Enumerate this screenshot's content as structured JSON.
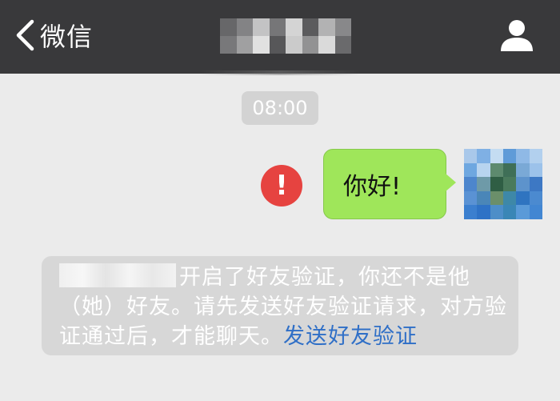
{
  "navbar": {
    "back_label": "微信",
    "title_obscured": true
  },
  "chat": {
    "timestamp": "08:00",
    "message": {
      "text": "你好!",
      "status": "send-failed",
      "error_glyph": "!"
    }
  },
  "system_notice": {
    "text_before": "开启了好友验证，你还不是他（她）好友。请先发送好友验证请求，对方验证通过后，才能聊天。",
    "link_text": "发送好友验证"
  },
  "colors": {
    "navbar_bg": "#39393b",
    "chat_bg": "#ebebeb",
    "bubble_green": "#9fe65a",
    "error_red": "#e64340",
    "link_blue": "#2f6fc7"
  },
  "icons": [
    "chevron-left-icon",
    "person-icon",
    "exclamation-icon"
  ]
}
